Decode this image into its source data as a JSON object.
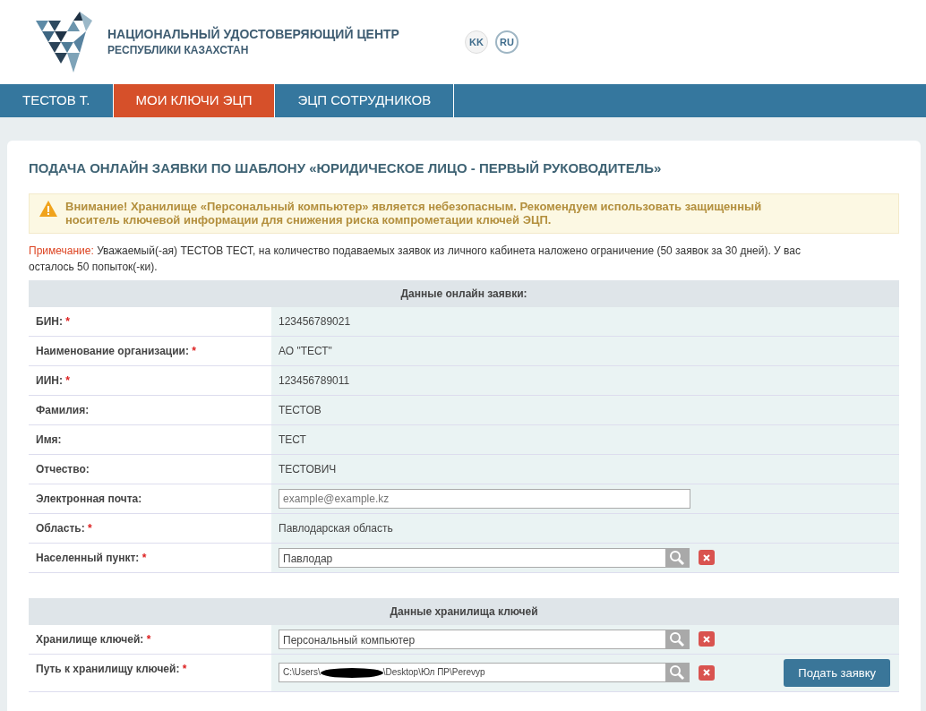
{
  "header": {
    "title": "НАЦИОНАЛЬНЫЙ УДОСТОВЕРЯЮЩИЙ ЦЕНТР",
    "subtitle": "РЕСПУБЛИКИ КАЗАХСТАН",
    "languages": [
      {
        "label": "KK",
        "selected": false
      },
      {
        "label": "RU",
        "selected": true
      }
    ]
  },
  "nav": [
    {
      "label": "ТЕСТОВ Т.",
      "selected": false
    },
    {
      "label": "МОИ КЛЮЧИ ЭЦП",
      "selected": true
    },
    {
      "label": "ЭЦП СОТРУДНИКОВ",
      "selected": false
    }
  ],
  "page_title": "ПОДАЧА ОНЛАЙН ЗАЯВКИ ПО ШАБЛОНУ «ЮРИДИЧЕСКОЕ ЛИЦО - ПЕРВЫЙ РУКОВОДИТЕЛЬ»",
  "warning": "Внимание! Хранилище «Персональный компьютер» является небезопасным. Рекомендуем использовать защищенный носитель ключевой информации для снижения риска компрометации ключей ЭЦП.",
  "note": {
    "label": "Примечание:",
    "text": "Уважаемый(-ая) ТЕСТОВ ТЕСТ, на количество подаваемых заявок из личного кабинета наложено ограничение (50 заявок за 30 дней). У вас осталось 50 попыток(-ки)."
  },
  "sections": [
    {
      "title": "Данные онлайн заявки:",
      "rows": [
        {
          "label": "БИН:",
          "required_mark": "*",
          "kind": "text",
          "value": "123456789021"
        },
        {
          "label": "Наименование организации:",
          "required_mark": "*",
          "kind": "text",
          "value": "АО \"ТЕСТ\""
        },
        {
          "label": "ИИН:",
          "required_mark": "*",
          "kind": "text",
          "value": "123456789011"
        },
        {
          "label": "Фамилия:",
          "kind": "text",
          "value": "ТЕСТОВ"
        },
        {
          "label": "Имя:",
          "kind": "text",
          "value": "ТЕСТ"
        },
        {
          "label": "Отчество:",
          "kind": "text",
          "value": "ТЕСТОВИЧ"
        },
        {
          "label": "Электронная почта:",
          "kind": "input",
          "placeholder": "example@example.kz"
        },
        {
          "label": "Область:",
          "required_mark": "*",
          "kind": "text",
          "value": "Павлодарская область"
        },
        {
          "label": "Населенный пункт:",
          "required_mark": "*",
          "kind": "lookup",
          "value": "Павлодар"
        }
      ]
    },
    {
      "title": "Данные хранилища ключей",
      "rows": [
        {
          "label": "Хранилище ключей:",
          "required_mark": "*",
          "kind": "lookup",
          "value": "Персональный компьютер"
        },
        {
          "label": "Путь к хранилищу ключей:",
          "required_mark": "*",
          "kind": "path",
          "value_start": "C:\\Users\\",
          "value_end": "\\Desktop\\Юл ПР\\Perevyp"
        }
      ]
    }
  ],
  "submit": "Подать заявку"
}
